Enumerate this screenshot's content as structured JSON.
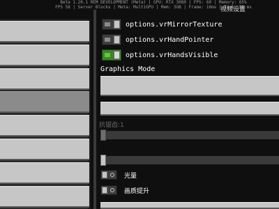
{
  "debug_line1": "Beta 1.20.1 REM DEVELOPMENT (Meta) | GPU: RTX 3080 | FPS: 60 | Memory: 65%",
  "debug_line2": "FPS 58 | Server Blocks | Meta: MultiGPU | Mem: 3GB | Frame: 16ms | Tick: 50 ms",
  "screen_title": "视频设置",
  "toggles": [
    {
      "label": "options.vrMirrorTexture",
      "state": "off"
    },
    {
      "label": "options.vrHandPointer",
      "state": "off"
    },
    {
      "label": "options.vrHandsVisible",
      "state": "on"
    }
  ],
  "graphics_mode_label": "Graphics Mode",
  "antialiasing_label": "抗锯齿:1",
  "small_toggles": [
    {
      "label": "光量",
      "state": "off"
    },
    {
      "label": "画质提升",
      "state": "off"
    }
  ]
}
